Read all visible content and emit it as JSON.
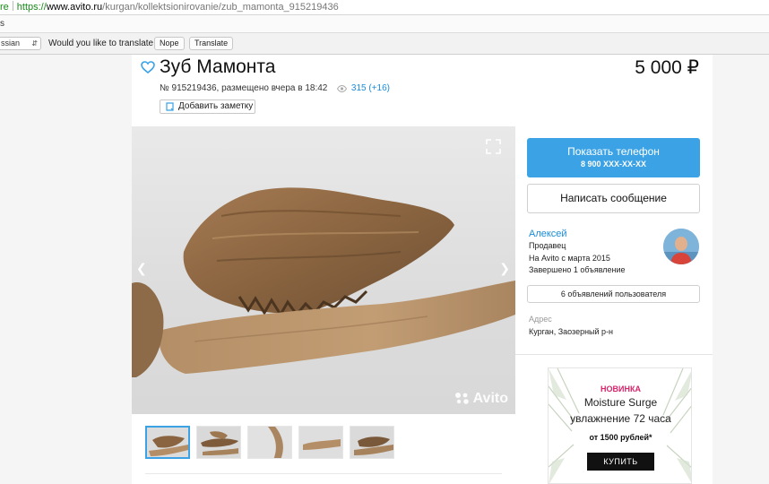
{
  "browser": {
    "secure_label": "re",
    "url_proto": "https://",
    "url_host": "www.avito.ru",
    "url_path": "/kurgan/kollektsionirovanie/zub_mamonta_915219436",
    "bookmarks_label": "s"
  },
  "translate_bar": {
    "language": "ssian",
    "question": "Would you like to translate it?",
    "nope_label": "Nope",
    "translate_label": "Translate"
  },
  "listing": {
    "title": "Зуб Мамонта",
    "price": "5 000 ₽",
    "meta": "№ 915219436, размещено вчера в 18:42",
    "views": "315 (+16)",
    "note_label": "Добавить заметку",
    "watermark": "Avito",
    "thumbnail_count": 5,
    "active_thumbnail": 0
  },
  "contact": {
    "phone_label": "Показать телефон",
    "phone_number": "8 900 XXX-XX-XX",
    "message_label": "Написать сообщение"
  },
  "seller": {
    "name": "Алексей",
    "role": "Продавец",
    "since": "На Avito с марта 2015",
    "completed": "Завершено 1 объявление",
    "ads_button": "6 объявлений пользователя",
    "address_label": "Адрес",
    "address_value": "Курган, Заозерный р-н"
  },
  "ad": {
    "badge": "НОВИНКА",
    "product": "Moisture Surge",
    "description": "увлажнение 72 часа",
    "price": "от 1500 рублей*",
    "buy_label": "КУПИТЬ"
  },
  "colors": {
    "accent": "#3aa2e5",
    "link": "#1a8cd8",
    "ad_badge": "#d6246c"
  }
}
